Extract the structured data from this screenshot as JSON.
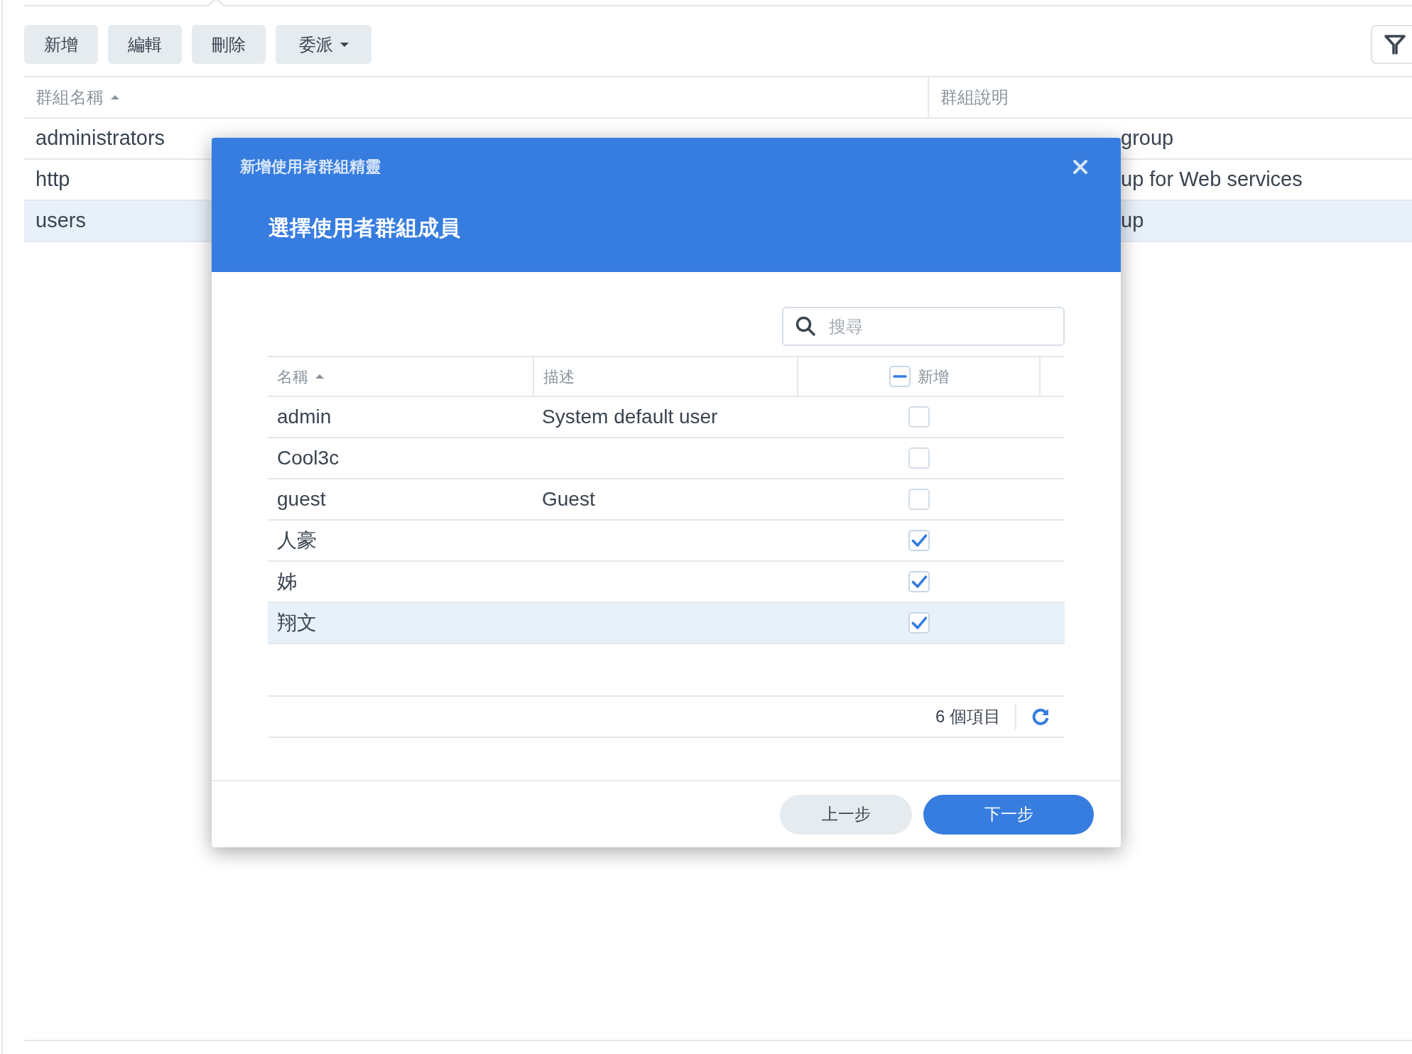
{
  "toolbar": {
    "buttons": [
      {
        "label": "新增",
        "kind": "plain"
      },
      {
        "label": "編輯",
        "kind": "plain"
      },
      {
        "label": "刪除",
        "kind": "plain"
      },
      {
        "label": "委派",
        "kind": "dropdown"
      }
    ]
  },
  "group_table": {
    "columns": [
      {
        "label": "群組名稱",
        "sorted": true
      },
      {
        "label": "群組說明",
        "sorted": false
      }
    ],
    "rows": [
      {
        "name": "administrators",
        "description": "group",
        "covered": true,
        "selected": false
      },
      {
        "name": "http",
        "description": "up for Web services",
        "covered": true,
        "selected": false
      },
      {
        "name": "users",
        "description": "up",
        "covered": true,
        "selected": true
      }
    ]
  },
  "dialog": {
    "subtitle": "新增使用者群組精靈",
    "title": "選擇使用者群組成員",
    "search": {
      "placeholder": "搜尋"
    },
    "columns": [
      {
        "label": "名稱",
        "kind": "text",
        "sorted": true
      },
      {
        "label": "描述",
        "kind": "text",
        "sorted": false
      },
      {
        "label": "新增",
        "kind": "checkbox",
        "sorted": false,
        "partially_checked": true
      }
    ],
    "rows": [
      {
        "name": "admin",
        "description": "System default user",
        "checked": false,
        "selected": false
      },
      {
        "name": "Cool3c",
        "checked": false,
        "selected": false
      },
      {
        "name": "guest",
        "description": "Guest",
        "checked": false,
        "selected": false
      },
      {
        "name": "人豪",
        "checked": true,
        "selected": false
      },
      {
        "name": "姊",
        "checked": true,
        "selected": false
      },
      {
        "name": "翔文",
        "checked": true,
        "selected": true
      }
    ],
    "item_count": "6 個項目",
    "buttons": [
      {
        "label": "上一步",
        "kind": "secondary"
      },
      {
        "label": "下一步",
        "kind": "primary"
      }
    ]
  }
}
